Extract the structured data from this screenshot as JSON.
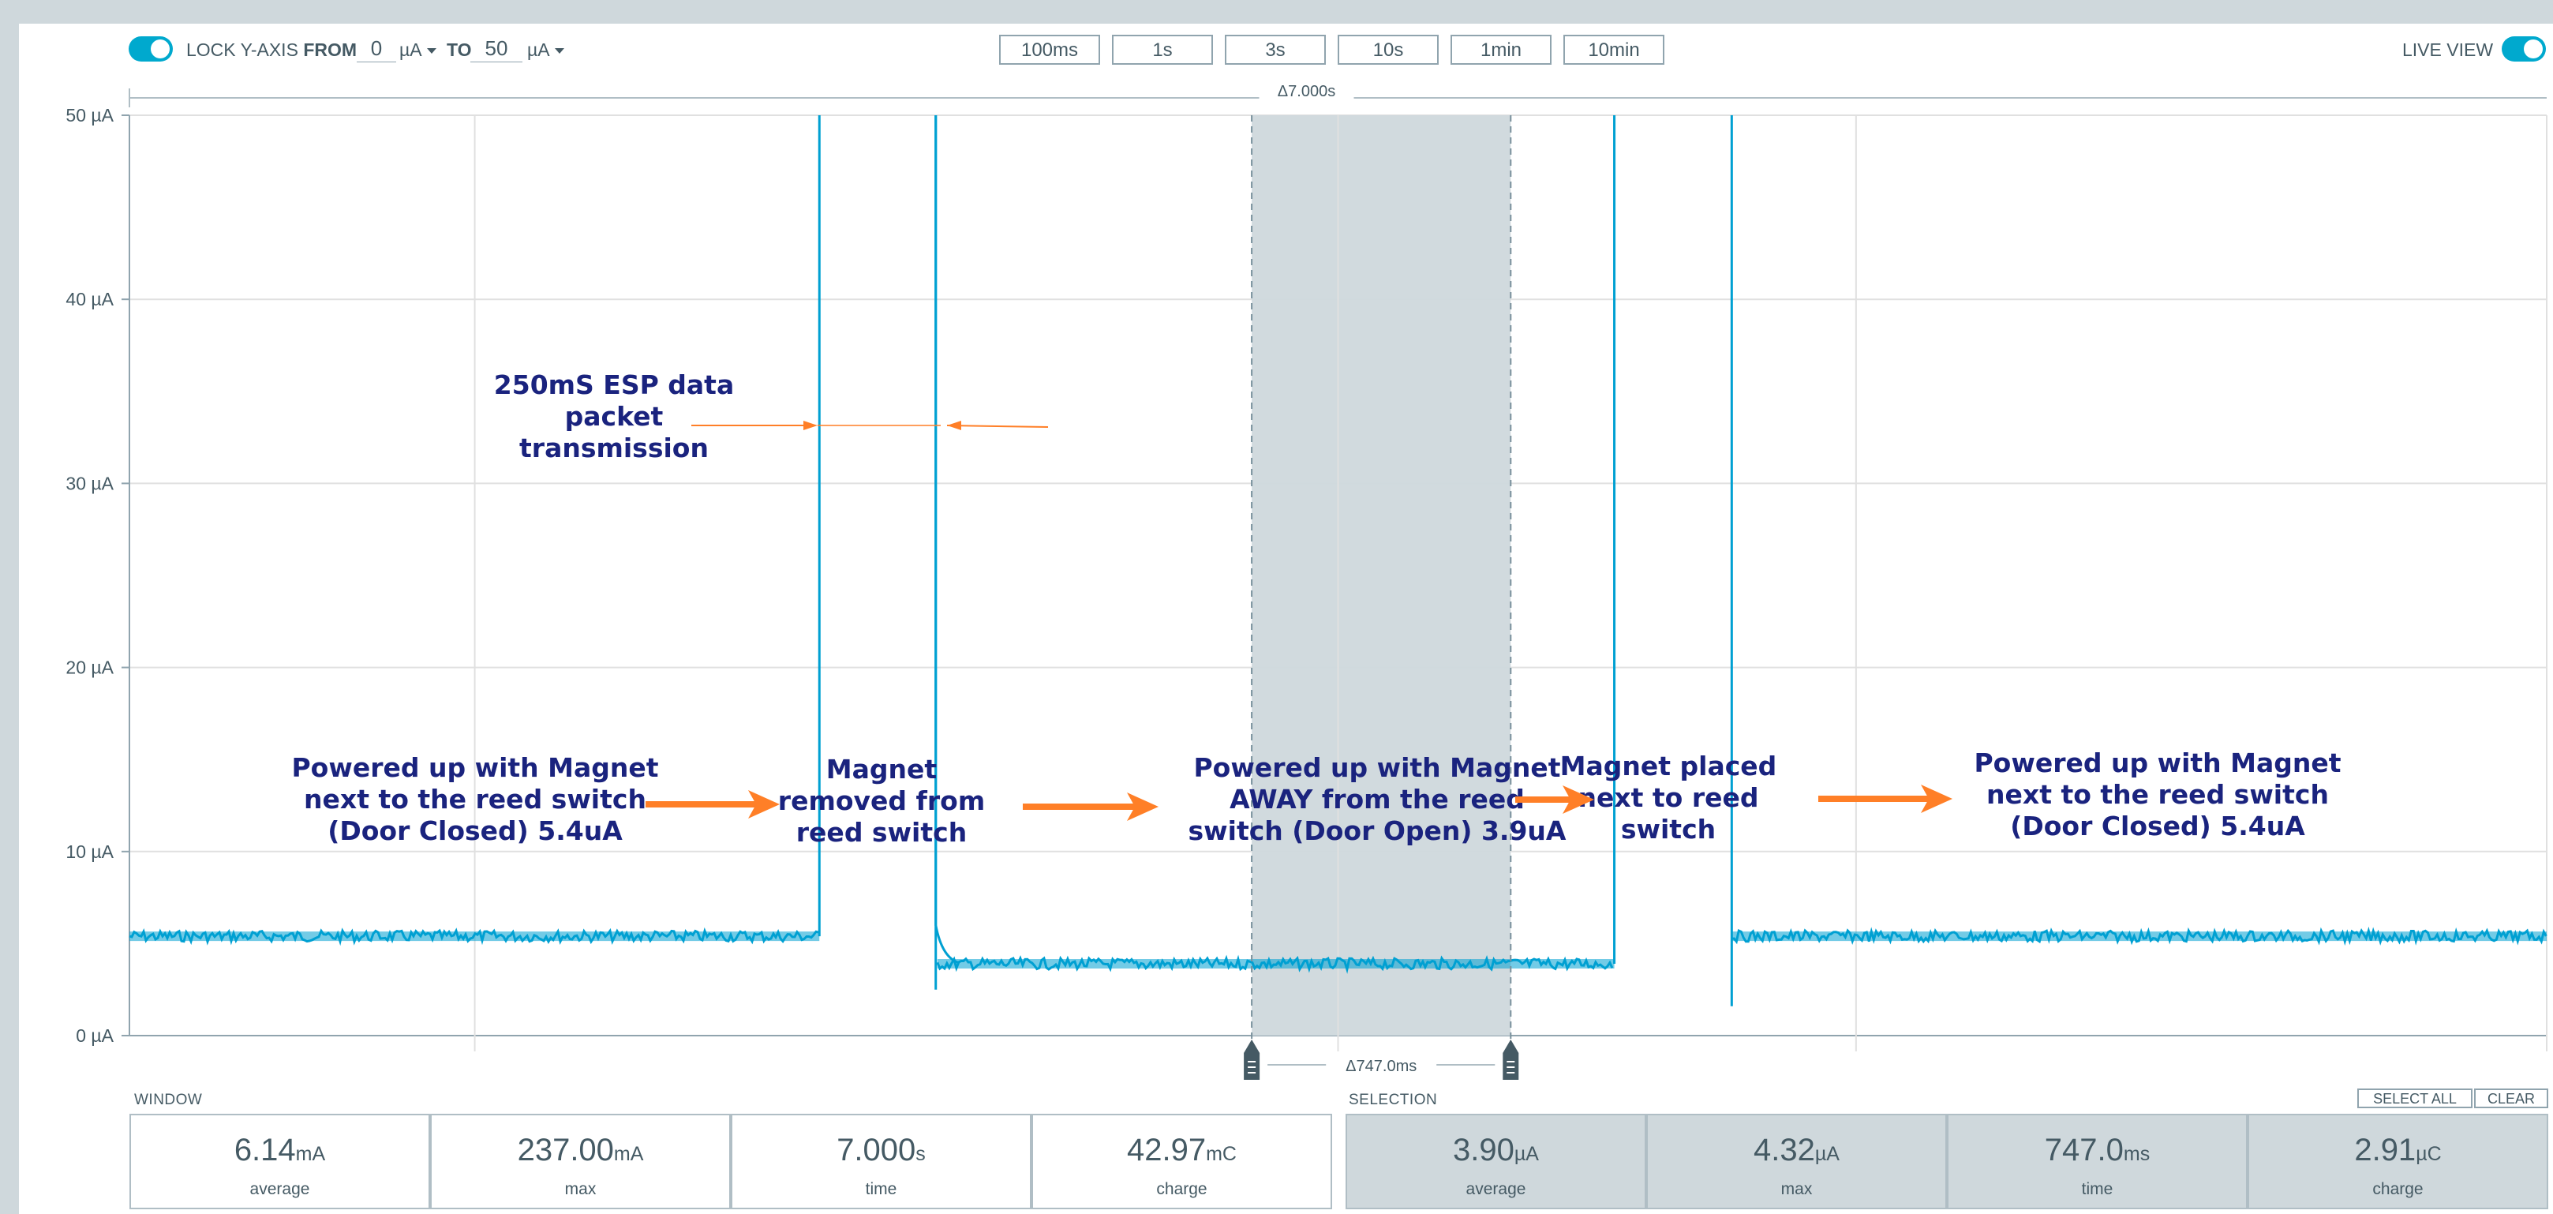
{
  "toolbar": {
    "lock_label": "LOCK Y-AXIS",
    "from_label": "FROM",
    "from_value": "0",
    "from_unit": "µA",
    "to_label": "TO",
    "to_value": "50",
    "to_unit": "µA",
    "live_label": "LIVE VIEW",
    "ranges": [
      "100ms",
      "1s",
      "3s",
      "10s",
      "1min",
      "10min"
    ]
  },
  "chart_data": {
    "type": "line",
    "ylim": [
      0,
      50
    ],
    "y_unit": "µA",
    "y_ticks": [
      "0 µA",
      "10 µA",
      "20 µA",
      "30 µA",
      "40 µA",
      "50 µA"
    ],
    "x_range_s": [
      0,
      7.0
    ],
    "window_delta_label": "Δ7.000s",
    "series": [
      {
        "color": "#00a0d2",
        "segments": [
          {
            "x": [
              0.0,
              1.998
            ],
            "level": 5.4
          },
          {
            "x": [
              2.34,
              4.3
            ],
            "level": 3.9
          },
          {
            "x": [
              4.64,
              7.0
            ],
            "level": 5.4
          }
        ],
        "spikes": [
          {
            "x": 1.998,
            "low": 5.4,
            "high": 50
          },
          {
            "x": 2.335,
            "low": 2.5,
            "high": 50
          },
          {
            "x": 4.3,
            "low": 3.9,
            "high": 50
          },
          {
            "x": 4.64,
            "low": 1.6,
            "high": 50
          }
        ]
      }
    ],
    "selection": {
      "x": [
        3.25,
        4.0
      ],
      "delta_label": "Δ747.0ms"
    },
    "annotations": [
      {
        "id": "a1",
        "lines": [
          "250mS ESP data",
          "packet",
          "transmission"
        ]
      },
      {
        "id": "a2",
        "lines": [
          "Powered up with Magnet",
          "next to the reed switch",
          "(Door Closed) 5.4uA"
        ]
      },
      {
        "id": "a3",
        "lines": [
          "Magnet",
          "removed from",
          "reed switch"
        ]
      },
      {
        "id": "a4",
        "lines": [
          "Powered up with Magnet",
          "AWAY from the reed",
          "switch (Door Open) 3.9uA"
        ]
      },
      {
        "id": "a5",
        "lines": [
          "Magnet placed",
          "next to reed",
          "switch"
        ]
      },
      {
        "id": "a6",
        "lines": [
          "Powered up with Magnet",
          "next to the reed switch",
          "(Door Closed) 5.4uA"
        ]
      }
    ],
    "annotation_color": "#1a237e",
    "arrow_color": "#ff7f27"
  },
  "window": {
    "title": "WINDOW",
    "stats": [
      {
        "value": "6.14",
        "unit": "mA",
        "label": "average"
      },
      {
        "value": "237.00",
        "unit": "mA",
        "label": "max"
      },
      {
        "value": "7.000",
        "unit": "s",
        "label": "time"
      },
      {
        "value": "42.97",
        "unit": "mC",
        "label": "charge"
      }
    ]
  },
  "selection": {
    "title": "SELECTION",
    "select_all": "SELECT ALL",
    "clear": "CLEAR",
    "stats": [
      {
        "value": "3.90",
        "unit": "µA",
        "label": "average"
      },
      {
        "value": "4.32",
        "unit": "µA",
        "label": "max"
      },
      {
        "value": "747.0",
        "unit": "ms",
        "label": "time"
      },
      {
        "value": "2.91",
        "unit": "µC",
        "label": "charge"
      }
    ]
  }
}
